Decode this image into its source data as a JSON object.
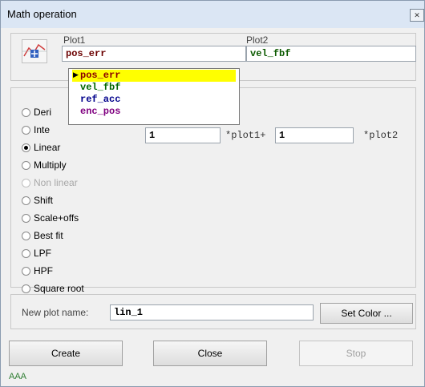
{
  "window": {
    "title": "Math operation",
    "close_glyph": "✕"
  },
  "plots": {
    "plot1_label": "Plot1",
    "plot1_value": "pos_err",
    "plot2_label": "Plot2",
    "plot2_value": "vel_fbf"
  },
  "dropdown": {
    "items": [
      "pos_err",
      "vel_fbf",
      "ref_acc",
      "enc_pos"
    ],
    "selected_index": 0,
    "colors": [
      "#8b0000",
      "#006400",
      "#00008b",
      "#800080"
    ]
  },
  "operations": {
    "selected": "Linear",
    "items": [
      {
        "label": "Deri",
        "disabled": false
      },
      {
        "label": "Inte",
        "disabled": false
      },
      {
        "label": "Linear",
        "disabled": false
      },
      {
        "label": "Multiply",
        "disabled": false
      },
      {
        "label": "Non linear",
        "disabled": true
      },
      {
        "label": "Shift",
        "disabled": false
      },
      {
        "label": "Scale+offs",
        "disabled": false
      },
      {
        "label": "Best fit",
        "disabled": false
      },
      {
        "label": "LPF",
        "disabled": false
      },
      {
        "label": "HPF",
        "disabled": false
      },
      {
        "label": "Square root",
        "disabled": false
      }
    ]
  },
  "linear": {
    "coef1": "1",
    "coef1_suffix": "*plot1+",
    "coef2": "1",
    "coef2_suffix": "*plot2"
  },
  "newplot": {
    "label": "New plot name:",
    "value": "lin_1",
    "set_color_label": "Set Color ..."
  },
  "buttons": {
    "create": "Create",
    "close": "Close",
    "stop": "Stop"
  },
  "status_text": "AAA",
  "colors": {
    "status": "#2e7d32",
    "titlebar": "#dbe6f4",
    "selection": "#ffff00"
  }
}
